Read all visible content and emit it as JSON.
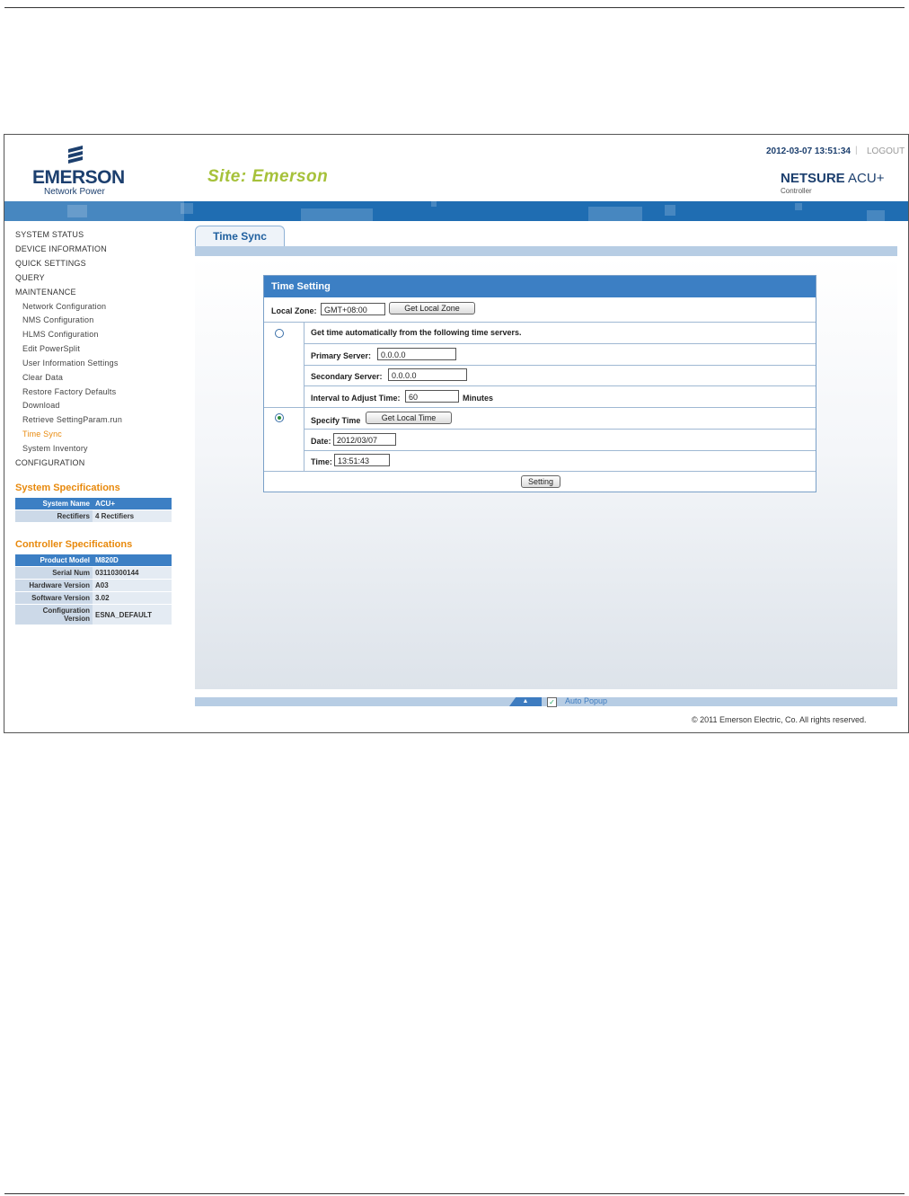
{
  "header": {
    "brand": "EMERSON",
    "brand_sub": "Network Power",
    "site_title": "Site: Emerson",
    "datetime": "2012-03-07 13:51:34",
    "separator": "|",
    "logout": "LOGOUT",
    "product_name": "NETSURE",
    "product_model": "ACU+",
    "product_sub": "Controller"
  },
  "sidebar": {
    "items": [
      {
        "label": "SYSTEM STATUS"
      },
      {
        "label": "DEVICE INFORMATION"
      },
      {
        "label": "QUICK SETTINGS"
      },
      {
        "label": "QUERY"
      },
      {
        "label": "MAINTENANCE"
      },
      {
        "label": "Network Configuration"
      },
      {
        "label": "NMS Configuration"
      },
      {
        "label": "HLMS Configuration"
      },
      {
        "label": "Edit PowerSplit"
      },
      {
        "label": "User Information Settings"
      },
      {
        "label": "Clear Data"
      },
      {
        "label": "Restore Factory Defaults"
      },
      {
        "label": "Download"
      },
      {
        "label": "Retrieve SettingParam.run"
      },
      {
        "label": "Time Sync"
      },
      {
        "label": "System Inventory"
      },
      {
        "label": "CONFIGURATION"
      }
    ],
    "system_spec": {
      "title": "System Specifications",
      "rows": [
        {
          "k": "System Name",
          "v": "ACU+"
        },
        {
          "k": "Rectifiers",
          "v": "4 Rectifiers"
        }
      ]
    },
    "controller_spec": {
      "title": "Controller Specifications",
      "rows": [
        {
          "k": "Product Model",
          "v": "M820D"
        },
        {
          "k": "Serial Num",
          "v": "03110300144"
        },
        {
          "k": "Hardware Version",
          "v": "A03"
        },
        {
          "k": "Software Version",
          "v": "3.02"
        },
        {
          "k": "Configuration Version",
          "v": "ESNA_DEFAULT"
        }
      ]
    }
  },
  "main": {
    "tab_label": "Time Sync",
    "panel_title": "Time Setting",
    "local_zone_label": "Local Zone:",
    "local_zone_value": "GMT+08:00",
    "get_local_zone": "Get Local Zone",
    "auto_label": "Get time automatically from the following time servers.",
    "primary_label": "Primary Server:",
    "primary_value": "0.0.0.0",
    "secondary_label": "Secondary Server:",
    "secondary_value": "0.0.0.0",
    "interval_label": "Interval to Adjust Time:",
    "interval_value": "60",
    "minutes_label": "Minutes",
    "specify_label": "Specify Time",
    "get_local_time": "Get Local Time",
    "date_label": "Date:",
    "date_value": "2012/03/07",
    "time_label": "Time:",
    "time_value": "13:51:43",
    "setting_button": "Setting"
  },
  "footer": {
    "auto_popup": "Auto Popup",
    "auto_popup_checked": true,
    "copyright": "© 2011 Emerson Electric, Co. All rights reserved."
  }
}
